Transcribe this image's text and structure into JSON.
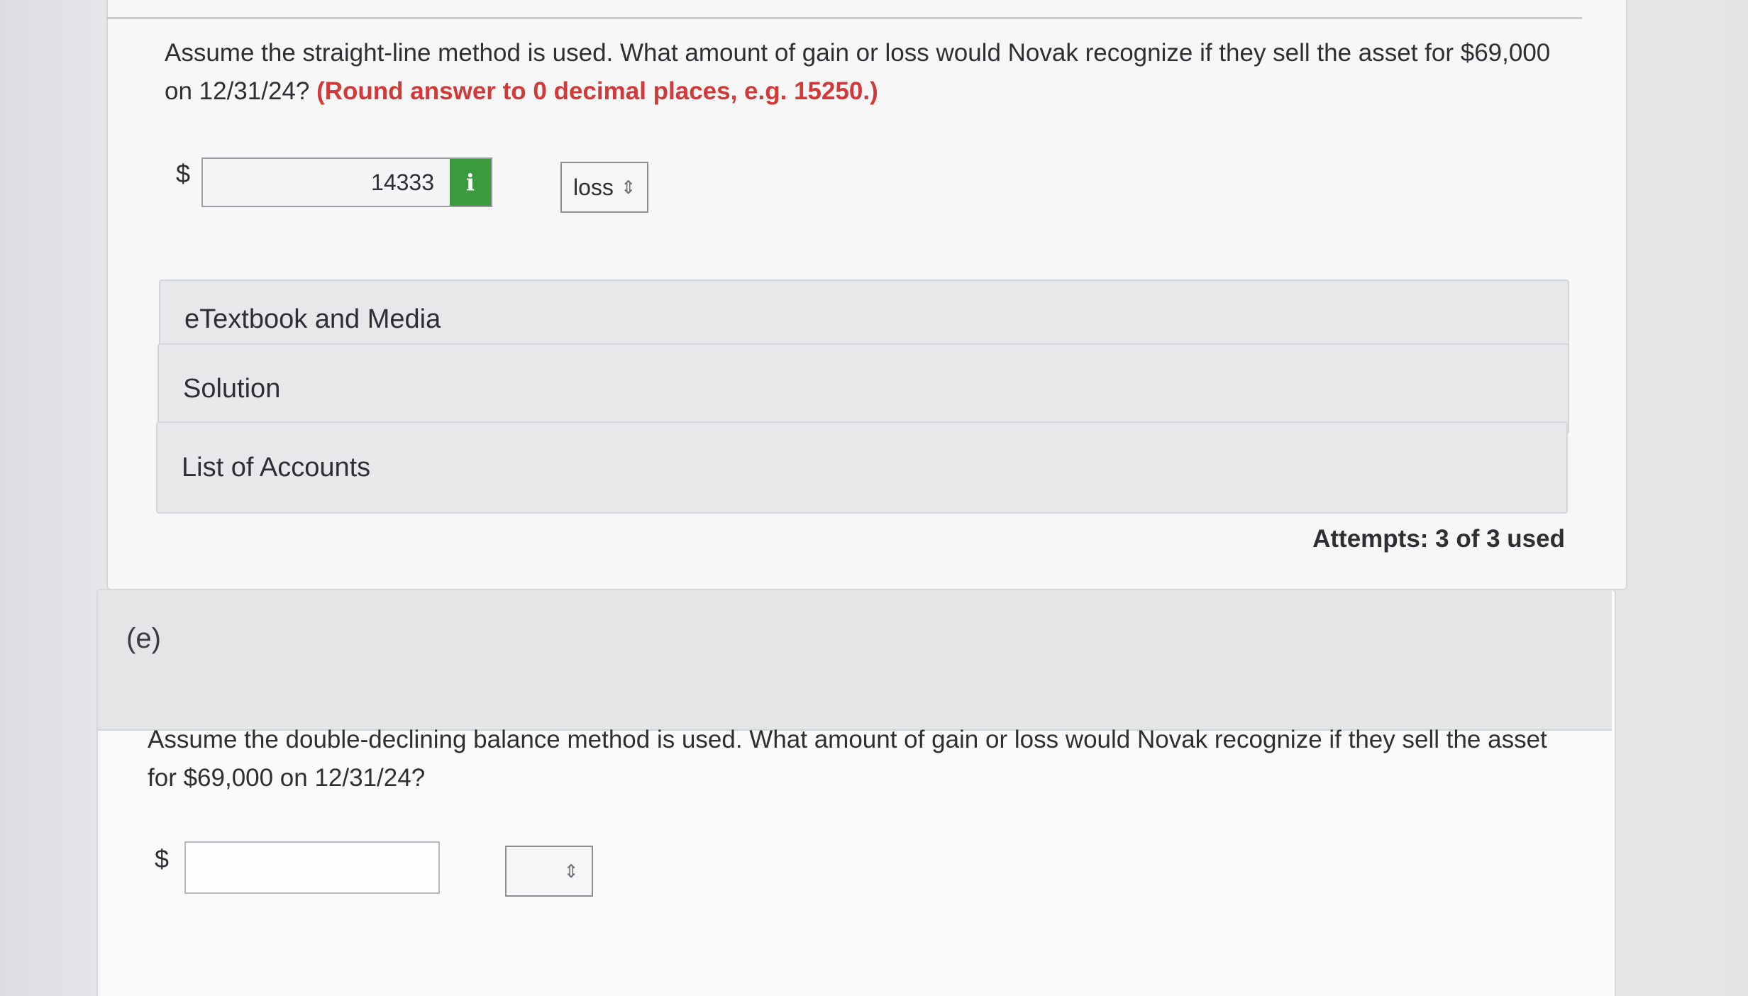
{
  "part_d": {
    "question": "Assume the straight-line method is used. What amount of gain or loss would Novak recognize if they sell the asset for $69,000 on 12/31/24?",
    "note": "(Round answer to 0 decimal places, e.g. 15250.)",
    "currency_symbol": "$",
    "answer_value": "14333",
    "info_icon_glyph": "i",
    "select_value": "loss",
    "attempts": "Attempts: 3 of 3 used"
  },
  "panels": {
    "etextbook": "eTextbook and Media",
    "solution": "Solution",
    "accounts": "List of Accounts"
  },
  "part_e": {
    "label": "(e)",
    "question": "Assume the double-declining balance method is used. What amount of gain or loss would Novak recognize if they sell the asset for $69,000 on 12/31/24?",
    "currency_symbol": "$",
    "answer_value": "",
    "select_value": ""
  },
  "colors": {
    "info_button": "#3b9a3e",
    "note_text": "#d23a3a"
  }
}
